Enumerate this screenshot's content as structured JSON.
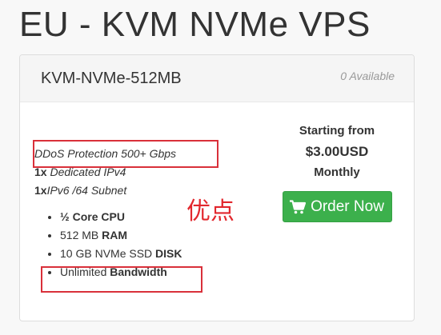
{
  "page": {
    "title": "EU - KVM NVMe VPS"
  },
  "product": {
    "name": "KVM-NVMe-512MB",
    "availability": "0 Available",
    "features": {
      "ddos": "DDoS Protection 500+ Gbps",
      "ipv4_qty": "1x",
      "ipv4_label": "Dedicated IPv4",
      "ipv6_qty": "1x",
      "ipv6_label": "IPv6 /64 Subnet"
    },
    "specs": [
      {
        "value": "½",
        "label": "Core CPU"
      },
      {
        "value": "512 MB",
        "label": "RAM"
      },
      {
        "value": "10 GB NVMe SSD",
        "label": "DISK"
      },
      {
        "value": "Unlimited",
        "label": "Bandwidth"
      }
    ],
    "pricing": {
      "starting_from": "Starting from",
      "price": "$3.00USD",
      "cycle": "Monthly"
    },
    "order_button": "Order Now",
    "order_icon": "cart-icon"
  },
  "annotation": {
    "text": "优点",
    "color": "#e2272d"
  },
  "colors": {
    "order_button": "#3cb04c",
    "highlight_box": "#d9303a"
  }
}
